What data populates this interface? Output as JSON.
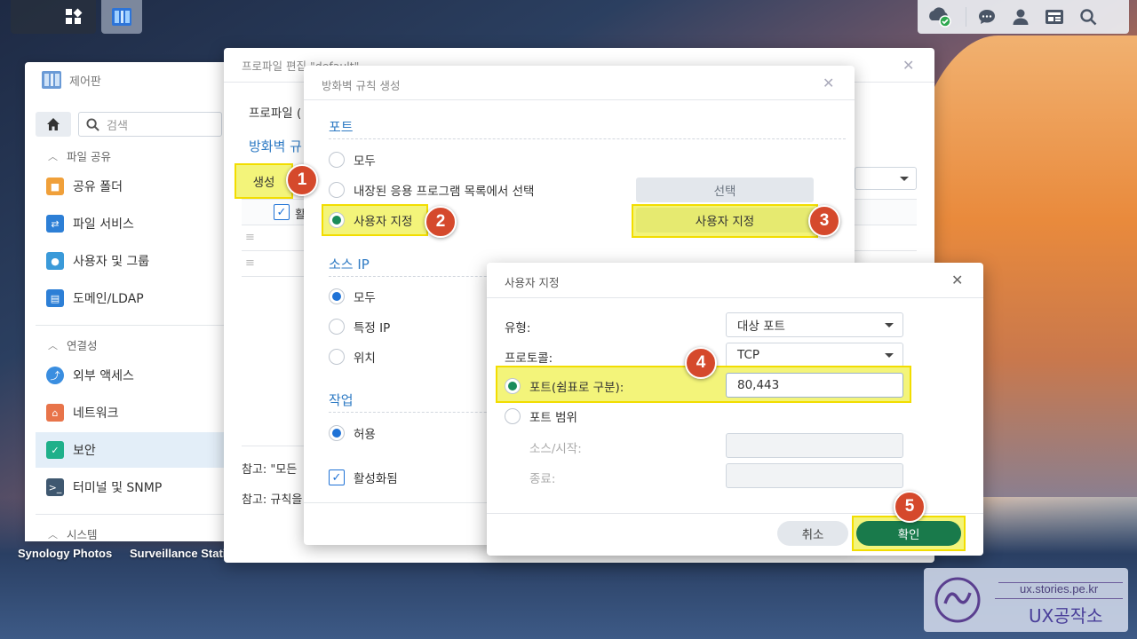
{
  "desktop": {
    "labels": [
      "Synology Photos",
      "Surveillance Stati"
    ]
  },
  "control_panel": {
    "title": "제어판",
    "search_placeholder": "검색",
    "sections": {
      "file_sharing": "파일 공유",
      "connectivity": "연결성",
      "system": "시스템"
    },
    "items": {
      "shared_folder": "공유 폴더",
      "file_services": "파일 서비스",
      "user_group": "사용자 및 그룹",
      "domain_ldap": "도메인/LDAP",
      "external_access": "외부 액세스",
      "network": "네트워크",
      "security": "보안",
      "terminal_snmp": "터미널 및 SNMP"
    }
  },
  "profile_editor": {
    "title": "프로파일 편집 \"default\"",
    "profile_label": "프로파일 (",
    "fw_rules_title": "방화벽 규",
    "create_button": "생성",
    "enable_col": "활",
    "note1": "참고: \"모든",
    "note2": "참고: 규칙을"
  },
  "firewall_dialog": {
    "title": "방화벽 규칙 생성",
    "port_section": "포트",
    "port_all": "모두",
    "port_builtin": "내장된 응용 프로그램 목록에서 선택",
    "port_custom": "사용자 지정",
    "select_button": "선택",
    "custom_button": "사용자 지정",
    "source_ip_section": "소스 IP",
    "ip_all": "모두",
    "ip_specific": "특정 IP",
    "ip_location": "위치",
    "action_section": "작업",
    "action_allow": "허용",
    "enabled_label": "활성화됨"
  },
  "custom_dialog": {
    "title": "사용자 지정",
    "type_label": "유형:",
    "type_value": "대상 포트",
    "protocol_label": "프로토콜:",
    "protocol_value": "TCP",
    "ports_label": "포트(쉼표로 구분):",
    "ports_value": "80,443",
    "port_range_label": "포트 범위",
    "source_start_label": "소스/시작:",
    "end_label": "종료:",
    "cancel_button": "취소",
    "ok_button": "확인"
  },
  "steps": [
    "1",
    "2",
    "3",
    "4",
    "5"
  ],
  "watermark": {
    "url": "ux.stories.pe.kr",
    "brand": "UX공작소"
  },
  "colors": {
    "accent_blue": "#2f7bc4",
    "ok_green": "#197a4b",
    "highlight": "#f3f47a",
    "badge": "#d5492c"
  }
}
